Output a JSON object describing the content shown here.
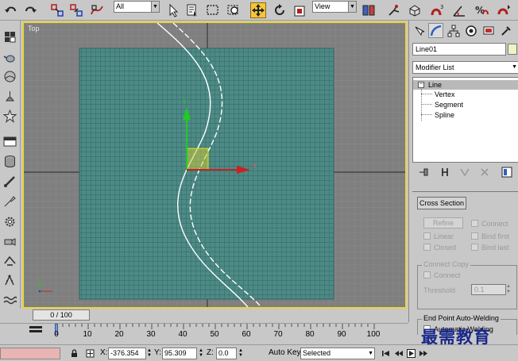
{
  "toolbar": {
    "selection_filter": "All",
    "reference_coord": "View"
  },
  "viewport": {
    "label": "Top",
    "gizmo_x_label": "x",
    "gizmo_y_label": "y"
  },
  "command_panel": {
    "object_name": "Line01",
    "modifier_list": "Modifier List",
    "stack": {
      "root": "Line",
      "children": [
        "Vertex",
        "Segment",
        "Spline"
      ]
    },
    "rollout": {
      "cross_section_label": "Cross Section",
      "refine_label": "Refine",
      "connect_label": "Connect",
      "linear_label": "Linear",
      "bind_first_label": "Bind first",
      "closed_label": "Closed",
      "bind_last_label": "Bind last",
      "connect_copy_title": "Connect Copy",
      "connect_copy_connect_label": "Connect",
      "threshold_label": "Threshold",
      "threshold_value": "0.1",
      "end_point_title": "End Point Auto-Welding",
      "automatic_welding_label": "Automatic Welding"
    }
  },
  "time": {
    "slider_text": "0 / 100",
    "track_labels": [
      "0",
      "10",
      "20",
      "30",
      "40",
      "50",
      "60",
      "70",
      "80",
      "90",
      "100"
    ]
  },
  "status": {
    "x_label": "X:",
    "x_value": "-376.354",
    "y_label": "Y:",
    "y_value": "95.309",
    "z_label": "Z:",
    "z_value": "0.0",
    "auto_key_label": "Auto Key",
    "key_filter_value": "Selected"
  },
  "watermark": "最需教育"
}
